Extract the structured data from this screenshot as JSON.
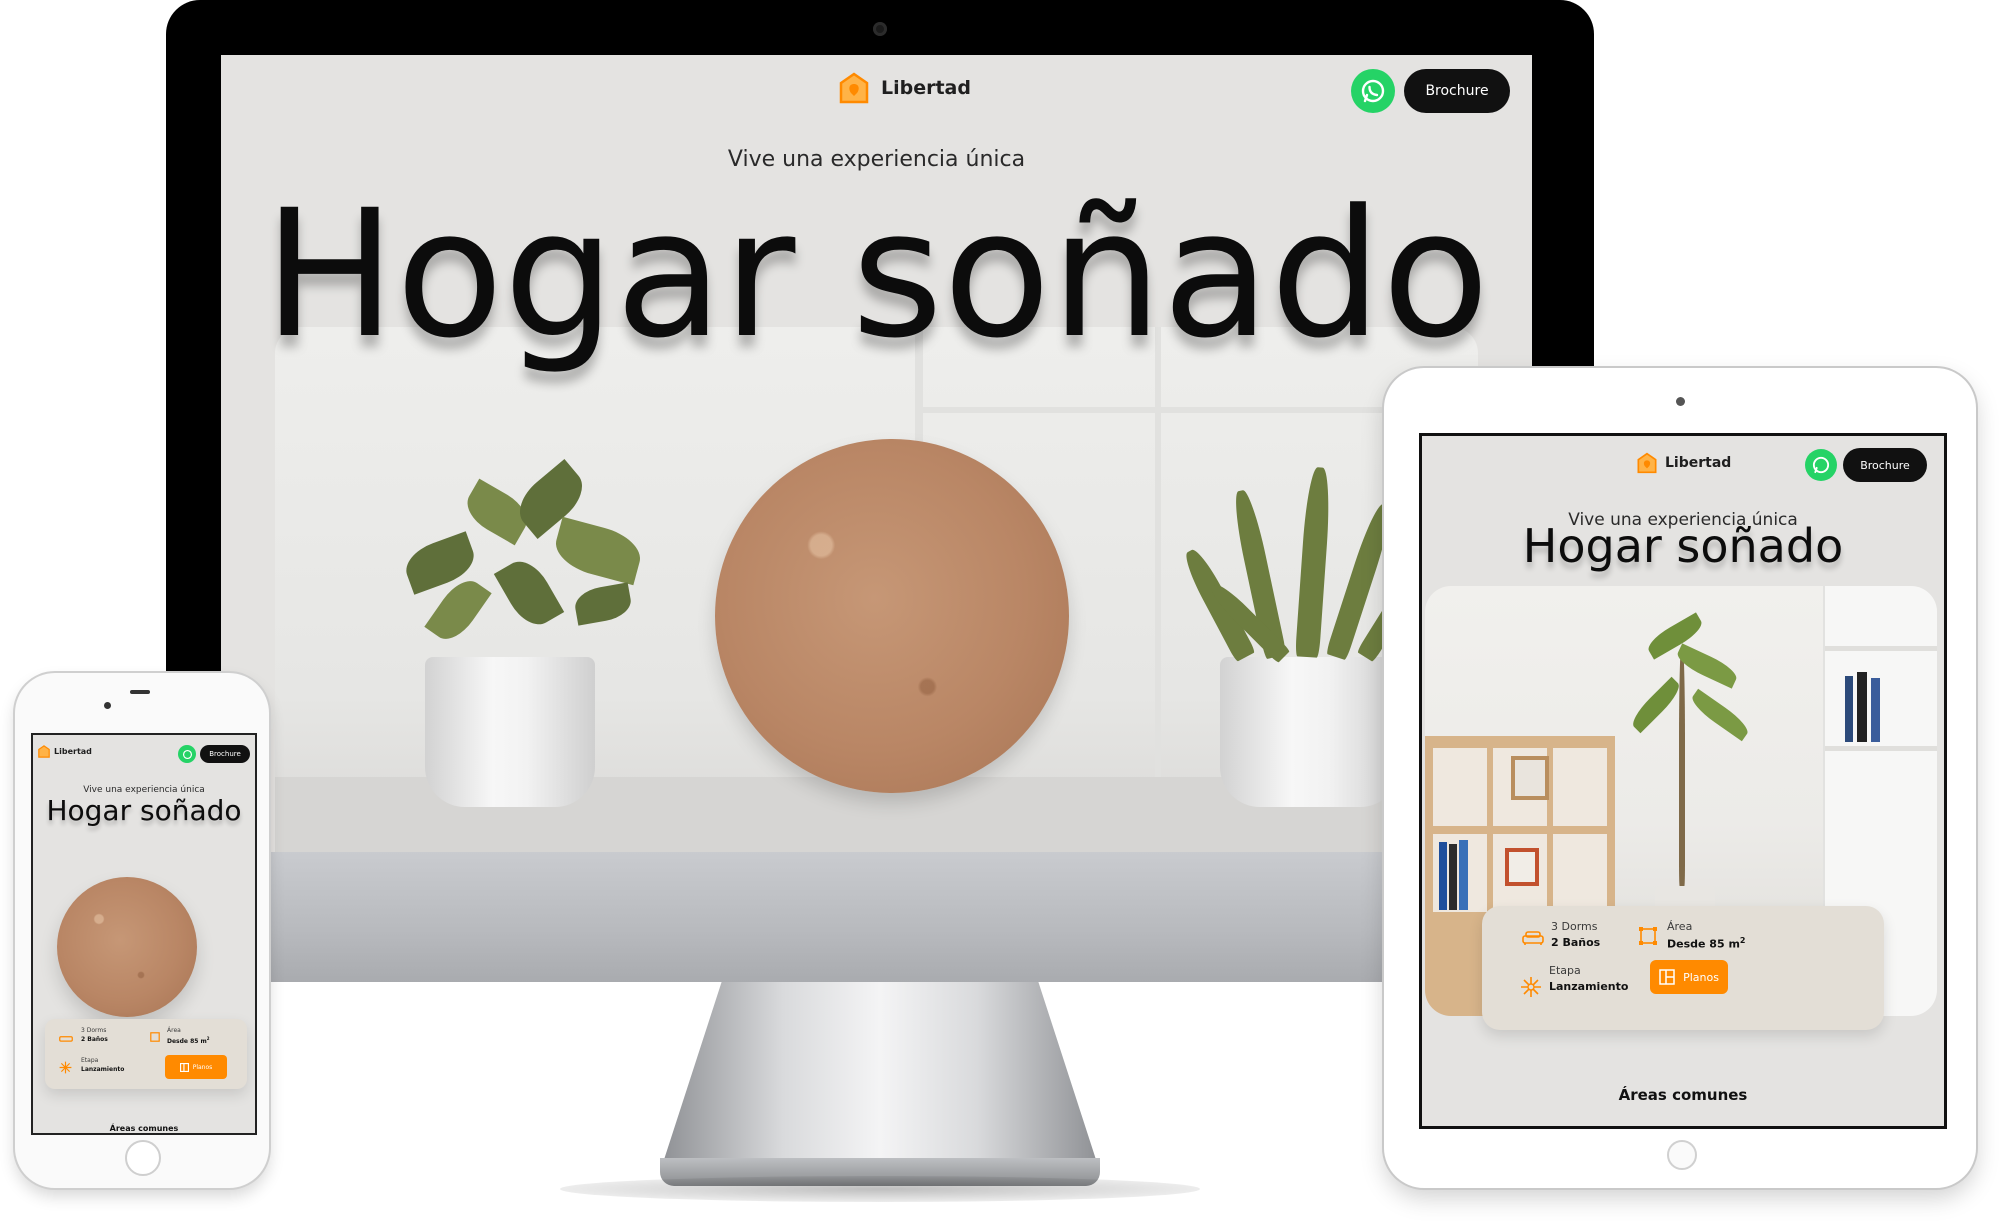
{
  "brand": {
    "name": "Libertad",
    "accent": "#ff8a00",
    "whatsapp_color": "#25d366"
  },
  "header": {
    "brochure_label": "Brochure",
    "whatsapp_icon": "whatsapp-icon"
  },
  "hero": {
    "tagline": "Vive una experiencia única",
    "headline": "Hogar soñado"
  },
  "features": {
    "rooms_line1": "3 Dorms",
    "rooms_line2": "2 Baños",
    "area_label": "Área",
    "area_value": "Desde 85 m",
    "area_unit_sup": "2",
    "stage_label": "Etapa",
    "stage_value": "Lanzamiento",
    "planos_label": "Planos",
    "icons": [
      "bed-icon",
      "area-icon",
      "snowflake-icon",
      "floorplan-icon"
    ]
  },
  "sections": {
    "common_areas": "Áreas comunes"
  }
}
